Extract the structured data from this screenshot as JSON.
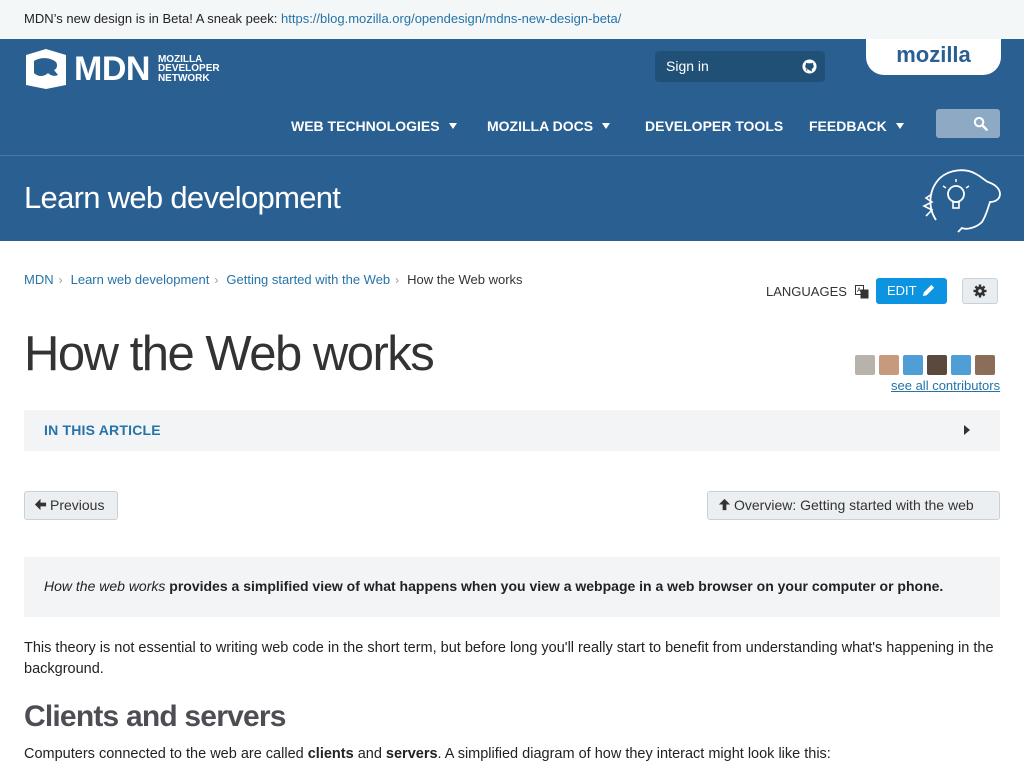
{
  "banner": {
    "text": "MDN’s new design is in Beta! A sneak peek: ",
    "link": "https://blog.mozilla.org/opendesign/mdns-new-design-beta/"
  },
  "header": {
    "logo_text": "MDN",
    "logo_sub": [
      "MOZILLA",
      "DEVELOPER",
      "NETWORK"
    ],
    "signin_label": "Sign in",
    "mozilla_tab": "mozilla",
    "nav": [
      {
        "label": "WEB TECHNOLOGIES",
        "has_caret": true
      },
      {
        "label": "MOZILLA DOCS",
        "has_caret": true
      },
      {
        "label": "DEVELOPER TOOLS",
        "has_caret": false
      },
      {
        "label": "FEEDBACK",
        "has_caret": true
      }
    ],
    "search_icon": "search-icon",
    "github_icon": "github-icon"
  },
  "hero": {
    "title": "Learn web development"
  },
  "breadcrumbs": [
    "MDN",
    "Learn web development",
    "Getting started with the Web",
    "How the Web works"
  ],
  "page_actions": {
    "languages_label": "LANGUAGES",
    "edit_label": "EDIT"
  },
  "article": {
    "title": "How the Web works",
    "contributors_link": "see all contributors",
    "toc_label": "IN THIS ARTICLE",
    "prev_label": "Previous",
    "up_label": "Overview: Getting started with the web",
    "summary_em": "How the web works",
    "summary_rest": " provides a simplified view of what happens when you view a webpage in a web browser on your computer or phone.",
    "para1": "This theory is not essential to writing web code in the short term, but before long you'll really start to benefit from understanding what's happening in the background.",
    "h2": "Clients and servers",
    "para2_parts": [
      "Computers connected to the web are called ",
      "clients",
      " and ",
      "servers",
      ". A simplified diagram of how they interact might look like this:"
    ]
  },
  "colors": {
    "brand_blue": "#2a5f92",
    "link_blue": "#2673a8",
    "edit_blue": "#0d94e0"
  }
}
